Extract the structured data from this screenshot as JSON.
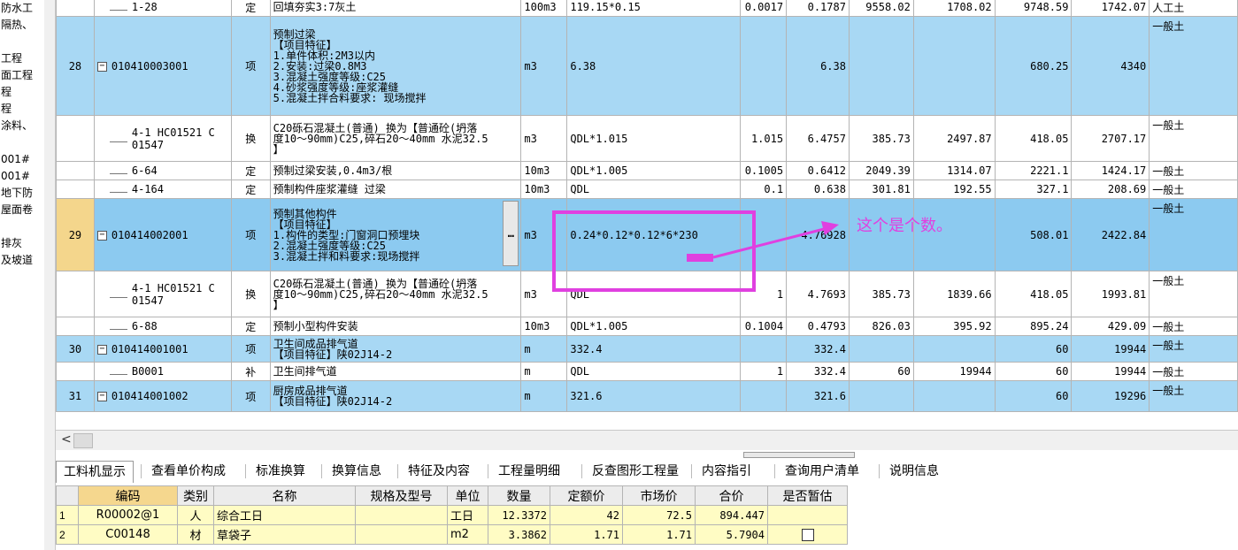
{
  "left_tree": [
    "防水工",
    "隔热、",
    "",
    "工程",
    "面工程",
    "程",
    "程",
    "涂料、",
    "",
    "001#",
    "001#",
    "地下防",
    "屋面卷",
    "",
    "排灰",
    "及坡道"
  ],
  "rows": [
    {
      "type": "sub",
      "rn": "",
      "code": "1-28",
      "kind": "定",
      "desc": [
        "回填夯实3:7灰土"
      ],
      "unit": "100m3",
      "expr": "119.15*0.15",
      "coef": "0.0017",
      "qty": "0.1787",
      "p1": "9558.02",
      "p2": "1708.02",
      "p3": "9748.59",
      "p4": "1742.07",
      "extra": "人工土"
    },
    {
      "type": "lvl1",
      "rn": "28",
      "code": "010410003001",
      "kind": "项",
      "desc": [
        "预制过梁",
        "【项目特征】",
        "1.单件体积:2M3以内",
        "2.安装:过梁0.8M3",
        "3.混凝土强度等级:C25",
        "4.砂浆强度等级:座浆灌缝",
        "5.混凝土拌合料要求: 现场搅拌"
      ],
      "unit": "m3",
      "expr": "6.38",
      "coef": "",
      "qty": "6.38",
      "p1": "",
      "p2": "",
      "p3": "680.25",
      "p4": "4340",
      "extra": "一般土"
    },
    {
      "type": "sub",
      "rn": "",
      "code": "4-1 HC01521 C 01547",
      "kind": "换",
      "desc": [
        "C20砾石混凝土(普通) 换为【普通砼(坍落",
        "度10～90mm)C25,碎石20～40mm 水泥32.5",
        "】"
      ],
      "unit": "m3",
      "expr": "QDL*1.015",
      "coef": "1.015",
      "qty": "6.4757",
      "p1": "385.73",
      "p2": "2497.87",
      "p3": "418.05",
      "p4": "2707.17",
      "extra": "一般土"
    },
    {
      "type": "sub",
      "rn": "",
      "code": "6-64",
      "kind": "定",
      "desc": [
        "预制过梁安装,0.4m3/根"
      ],
      "unit": "10m3",
      "expr": "QDL*1.005",
      "coef": "0.1005",
      "qty": "0.6412",
      "p1": "2049.39",
      "p2": "1314.07",
      "p3": "2221.1",
      "p4": "1424.17",
      "extra": "一般土"
    },
    {
      "type": "sub",
      "rn": "",
      "code": "4-164",
      "kind": "定",
      "desc": [
        "预制构件座浆灌缝 过梁"
      ],
      "unit": "10m3",
      "expr": "QDL",
      "coef": "0.1",
      "qty": "0.638",
      "p1": "301.81",
      "p2": "192.55",
      "p3": "327.1",
      "p4": "208.69",
      "extra": "一般土"
    },
    {
      "type": "sel",
      "rn": "29",
      "code": "010414002001",
      "kind": "项",
      "desc": [
        "预制其他构件",
        "【项目特征】",
        "1.构件的类型:门窗洞口预埋块",
        "2.混凝土强度等级:C25",
        "3.混凝土拌和料要求:现场搅拌"
      ],
      "unit": "m3",
      "expr": "0.24*0.12*0.12*6*230",
      "coef": "",
      "qty": "4.76928",
      "p1": "",
      "p2": "",
      "p3": "508.01",
      "p4": "2422.84",
      "extra": "一般土"
    },
    {
      "type": "sub",
      "rn": "",
      "code": "4-1 HC01521 C 01547",
      "kind": "换",
      "desc": [
        "C20砾石混凝土(普通) 换为【普通砼(坍落",
        "度10～90mm)C25,碎石20～40mm 水泥32.5",
        "】"
      ],
      "unit": "m3",
      "expr": "QDL",
      "coef": "1",
      "qty": "4.7693",
      "p1": "385.73",
      "p2": "1839.66",
      "p3": "418.05",
      "p4": "1993.81",
      "extra": "一般土"
    },
    {
      "type": "sub",
      "rn": "",
      "code": "6-88",
      "kind": "定",
      "desc": [
        "预制小型构件安装"
      ],
      "unit": "10m3",
      "expr": "QDL*1.005",
      "coef": "0.1004",
      "qty": "0.4793",
      "p1": "826.03",
      "p2": "395.92",
      "p3": "895.24",
      "p4": "429.09",
      "extra": "一般土"
    },
    {
      "type": "lvl1",
      "rn": "30",
      "code": "010414001001",
      "kind": "项",
      "desc": [
        "卫生间成品排气道",
        "【项目特征】陕02J14-2"
      ],
      "unit": "m",
      "expr": "332.4",
      "coef": "",
      "qty": "332.4",
      "p1": "",
      "p2": "",
      "p3": "60",
      "p4": "19944",
      "extra": "一般土"
    },
    {
      "type": "sub",
      "rn": "",
      "code": "B0001",
      "kind": "补",
      "desc": [
        "卫生间排气道"
      ],
      "unit": "m",
      "expr": "QDL",
      "coef": "1",
      "qty": "332.4",
      "p1": "60",
      "p2": "19944",
      "p3": "60",
      "p4": "19944",
      "extra": "一般土"
    },
    {
      "type": "lvl1",
      "rn": "31",
      "code": "010414001002",
      "kind": "项",
      "desc": [
        "厨房成品排气道",
        "【项目特征】陕02J14-2"
      ],
      "unit": "m",
      "expr": "321.6",
      "coef": "",
      "qty": "321.6",
      "p1": "",
      "p2": "",
      "p3": "60",
      "p4": "19296",
      "extra": "一般土"
    }
  ],
  "ellipsis": "…",
  "hscroll_arrow": "<",
  "tabs": [
    "工料机显示",
    "查看单价构成",
    "标准换算",
    "换算信息",
    "特征及内容",
    "工程量明细",
    "反查图形工程量",
    "内容指引",
    "查询用户清单",
    "说明信息"
  ],
  "bottom_headers": [
    "",
    "编码",
    "类别",
    "名称",
    "规格及型号",
    "单位",
    "数量",
    "定额价",
    "市场价",
    "合价",
    "是否暂估"
  ],
  "bottom_rows": [
    {
      "rn": "1",
      "code": "R00002@1",
      "kind": "人",
      "name": "综合工日",
      "spec": "",
      "unit": "工日",
      "qty": "12.3372",
      "quota": "42",
      "market": "72.5",
      "total": "894.447",
      "est": ""
    },
    {
      "rn": "2",
      "code": "C00148",
      "kind": "材",
      "name": "草袋子",
      "spec": "",
      "unit": "m2",
      "qty": "3.3862",
      "quota": "1.71",
      "market": "1.71",
      "total": "5.7904",
      "est": "checkbox"
    }
  ],
  "annotation": {
    "text": "这个是个数。",
    "color": "#e040e0"
  }
}
